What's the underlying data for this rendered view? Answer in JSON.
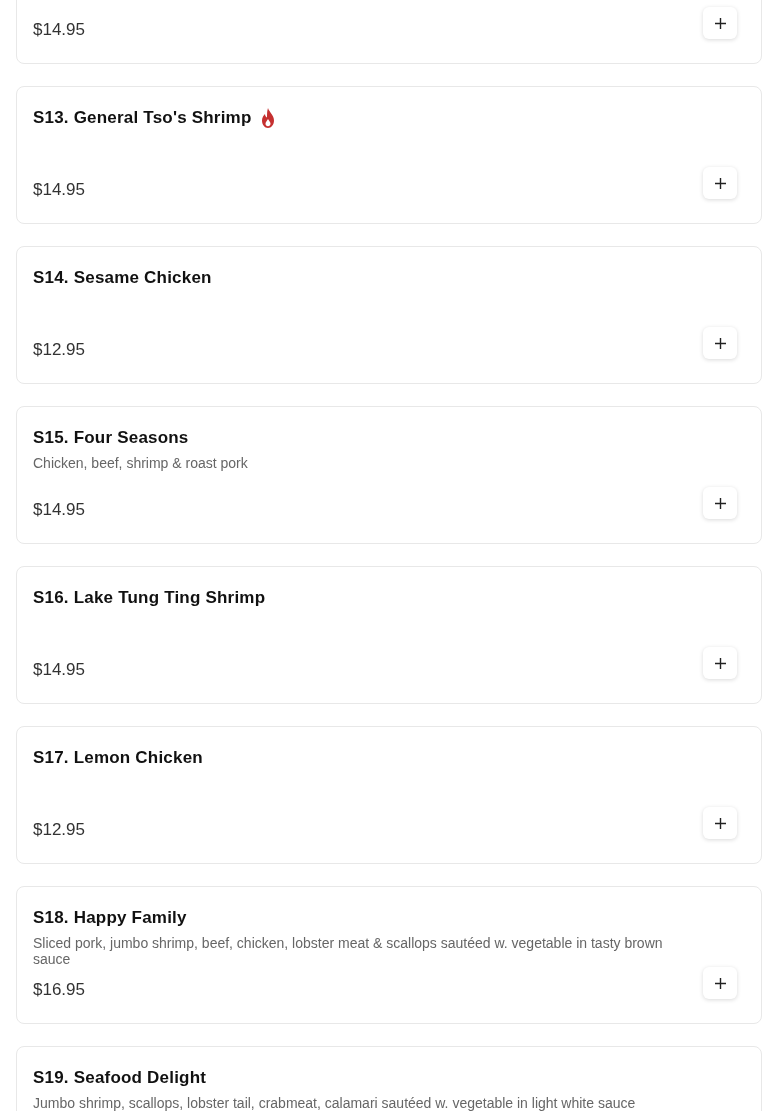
{
  "items": [
    {
      "price": "$14.95"
    },
    {
      "name": "S13. General Tso's Shrimp",
      "spicy": true,
      "price": "$14.95"
    },
    {
      "name": "S14. Sesame Chicken",
      "spicy": false,
      "price": "$12.95"
    },
    {
      "name": "S15. Four Seasons",
      "spicy": false,
      "description": "Chicken, beef, shrimp & roast pork",
      "price": "$14.95"
    },
    {
      "name": "S16. Lake Tung Ting Shrimp",
      "spicy": false,
      "price": "$14.95"
    },
    {
      "name": "S17. Lemon Chicken",
      "spicy": false,
      "price": "$12.95"
    },
    {
      "name": "S18. Happy Family",
      "spicy": false,
      "description": "Sliced pork, jumbo shrimp, beef, chicken, lobster meat & scallops sautéed w. vegetable in tasty brown sauce",
      "price": "$16.95"
    },
    {
      "name": "S19. Seafood Delight",
      "spicy": false,
      "description": "Jumbo shrimp, scallops, lobster tail, crabmeat, calamari sautéed w. vegetable in light white sauce"
    }
  ]
}
